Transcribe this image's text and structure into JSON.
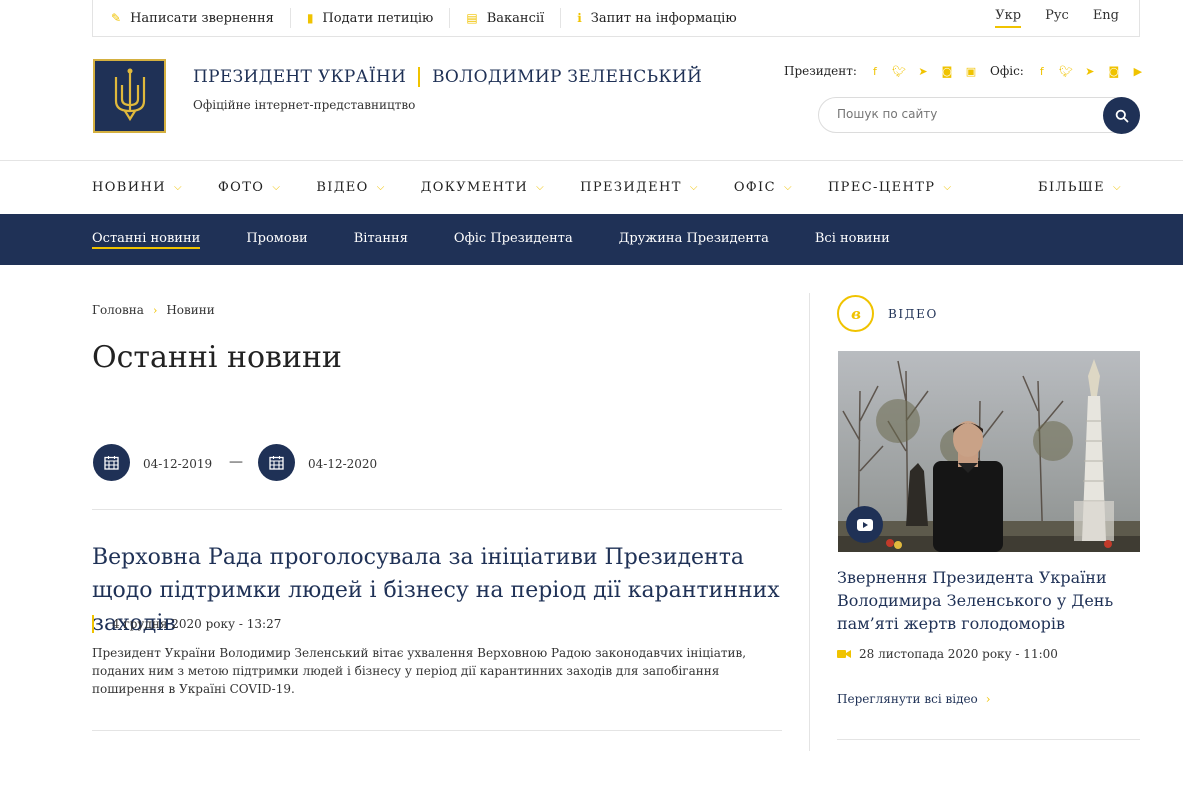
{
  "topbar": {
    "links": [
      {
        "label": "Написати звернення",
        "icon": "pencil-icon",
        "glyph": "✎"
      },
      {
        "label": "Подати петицію",
        "icon": "document-icon",
        "glyph": "▮"
      },
      {
        "label": "Вакансії",
        "icon": "file-icon",
        "glyph": "▤"
      },
      {
        "label": "Запит на інформацію",
        "icon": "info-icon",
        "glyph": "ℹ"
      }
    ],
    "languages": [
      "Укр",
      "Рус",
      "Eng"
    ]
  },
  "header": {
    "title_left": "ПРЕЗИДЕНТ УКРАЇНИ",
    "title_right": "ВОЛОДИМИР ЗЕЛЕНСЬКИЙ",
    "subtitle": "Офіційне інтернет-представництво",
    "president_label": "Президент:",
    "office_label": "Офіс:",
    "search_placeholder": "Пошук по сайту"
  },
  "main_nav": [
    "НОВИНИ",
    "ФОТО",
    "ВІДЕО",
    "ДОКУМЕНТИ",
    "ПРЕЗИДЕНТ",
    "ОФІС",
    "ПРЕС-ЦЕНТР"
  ],
  "more_label": "БІЛЬШЕ",
  "sub_nav": [
    "Останні новини",
    "Промови",
    "Вітання",
    "Офіс Президента",
    "Дружина Президента",
    "Всі новини"
  ],
  "breadcrumb": [
    "Головна",
    "Новини"
  ],
  "page_title": "Останні новини",
  "date_filter": {
    "from": "04-12-2019",
    "separator": "—",
    "to": "04-12-2020"
  },
  "article": {
    "title": "Верховна Рада проголосувала за ініціативи Президента щодо підтримки людей і бізнесу на період дії карантинних заходів",
    "date": "4 грудня 2020 року - 13:27",
    "text": "Президент України Володимир Зеленський вітає ухвалення Верховною Радою законодавчих ініціатив, поданих ним з метою підтримки людей і бізнесу у період дії карантинних заходів для запобігання поширення в Україні COVID-19."
  },
  "sidebar": {
    "heading": "ВІДЕО",
    "video_title": "Звернення Президента України Володимира Зеленського у День пам’яті жертв голодоморів",
    "video_date": "28 листопада 2020 року - 11:00",
    "view_all": "Переглянути всі відео"
  },
  "colors": {
    "navy": "#1f3156",
    "gold": "#f0c300"
  }
}
